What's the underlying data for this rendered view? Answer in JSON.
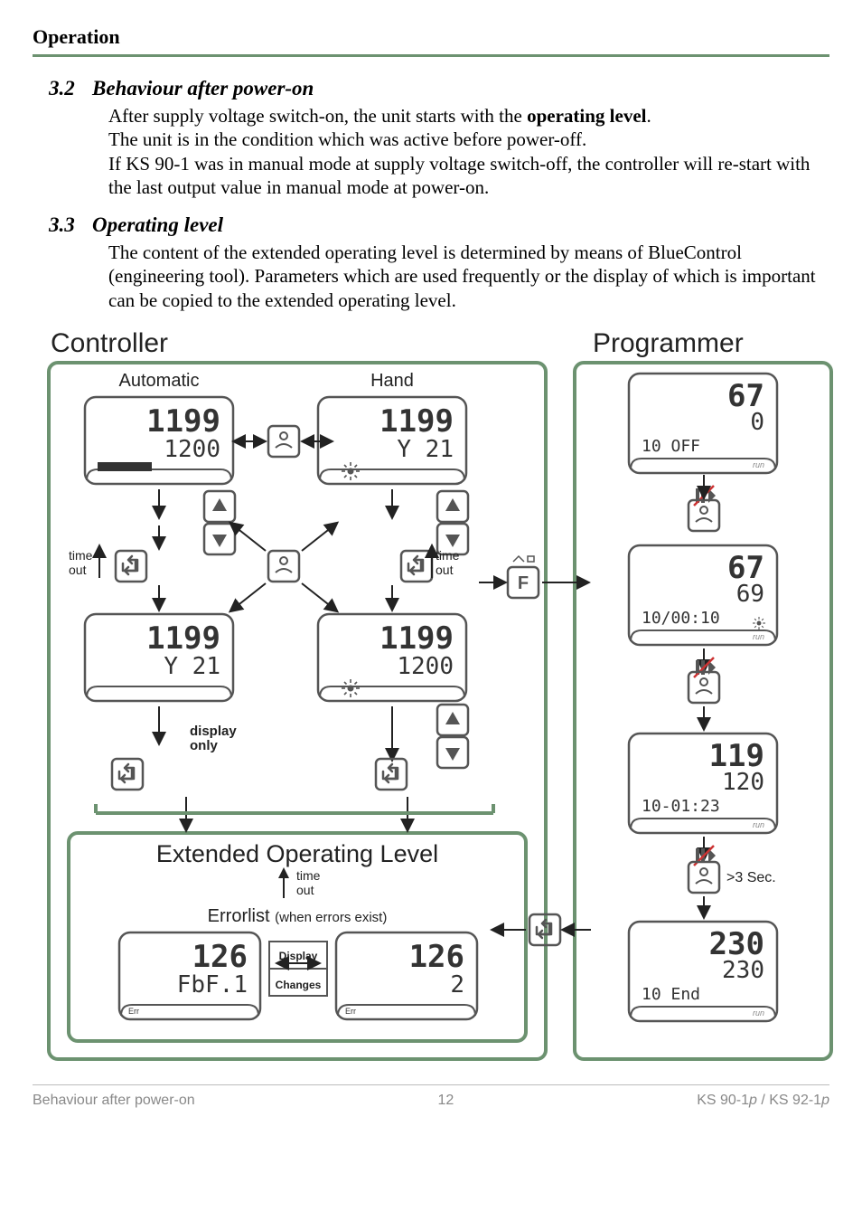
{
  "header": {
    "title": "Operation"
  },
  "sections": {
    "s32": {
      "num": "3.2",
      "title": "Behaviour after power-on",
      "p1a": "After supply voltage switch-on, the unit starts with the ",
      "p1b": "operating level",
      "p1c": ".",
      "p2": "The unit is in the condition which was active before power-off.",
      "p3": "If KS 90-1 was in manual mode at supply voltage switch-off, the controller will re-start with the last output value in manual mode at power-on."
    },
    "s33": {
      "num": "3.3",
      "title": "Operating level",
      "p1": "The content of the extended operating level is determined by means of BlueControl (engineering tool). Parameters which are used frequently or the display of which is important can be copied to the extended operating level."
    }
  },
  "diagram": {
    "controller_title": "Controller",
    "programmer_title": "Programmer",
    "automatic_label": "Automatic",
    "hand_label": "Hand",
    "timeout_label_1": "time",
    "timeout_label_2": "out",
    "display_only_1": "display",
    "display_only_2": "only",
    "ext_op_level": "Extended Operating Level",
    "errorlist_a": "Errorlist ",
    "errorlist_b": "(when errors exist)",
    "disp_changes_1": "Display",
    "disp_changes_2": "Changes",
    "gt3sec": ">3 Sec.",
    "icon_F": "F",
    "screens": {
      "c_auto_top": {
        "top": "1199",
        "bot": "1200"
      },
      "c_auto_bot": {
        "top": "1199",
        "bot": "Y 21"
      },
      "c_hand_top": {
        "top": "1199",
        "bot": "Y 21"
      },
      "c_hand_bot": {
        "top": "1199",
        "bot": "1200"
      },
      "c_err_left": {
        "top": "126",
        "bot": "FbF.1"
      },
      "c_err_right": {
        "top": "126",
        "bot": "2"
      },
      "p1": {
        "top": "67",
        "bot": "0",
        "line": "10 OFF"
      },
      "p2": {
        "top": "67",
        "bot": "69",
        "line": "10/00:10"
      },
      "p3": {
        "top": "119",
        "bot": "120",
        "line": "10-01:23"
      },
      "p4": {
        "top": "230",
        "bot": "230",
        "line": "10 End"
      }
    },
    "run_label": "run",
    "err_label": "Err"
  },
  "footer": {
    "left": "Behaviour after power-on",
    "center": "12",
    "right_a": "KS 90-1",
    "right_p1": "p",
    "right_b": " / KS 92-1",
    "right_p2": "p"
  }
}
